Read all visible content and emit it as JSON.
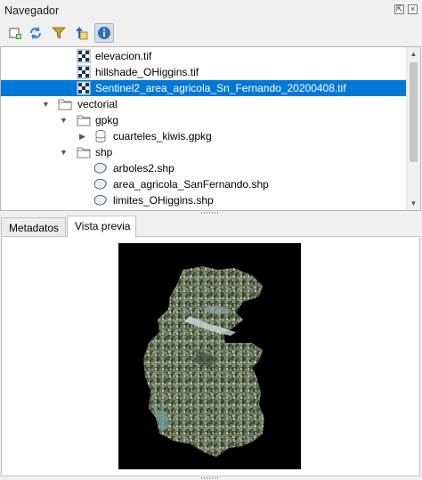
{
  "panel": {
    "title": "Navegador",
    "float_icon": "float-icon",
    "close_icon": "close-icon"
  },
  "toolbar": [
    {
      "name": "add-layer-button",
      "icon": "add-layer-icon"
    },
    {
      "name": "refresh-button",
      "icon": "refresh-icon"
    },
    {
      "name": "filter-button",
      "icon": "filter-icon"
    },
    {
      "name": "collapse-all-button",
      "icon": "collapse-icon"
    },
    {
      "name": "properties-button",
      "icon": "info-icon",
      "active": true
    }
  ],
  "tree": {
    "items": [
      {
        "label": "elevacion.tif",
        "icon": "raster-icon",
        "level": 3
      },
      {
        "label": "hillshade_OHiggins.tif",
        "icon": "raster-icon",
        "level": 3
      },
      {
        "label": "Sentinel2_area_agricola_Sn_Fernando_20200408.tif",
        "icon": "raster-icon",
        "level": 3,
        "selected": true
      },
      {
        "label": "vectorial",
        "icon": "folder-icon",
        "level": 2,
        "expanded": true
      },
      {
        "label": "gpkg",
        "icon": "folder-icon",
        "level": 3,
        "expanded": true
      },
      {
        "label": "cuarteles_kiwis.gpkg",
        "icon": "database-icon",
        "level": 4,
        "collapsed": true
      },
      {
        "label": "shp",
        "icon": "folder-icon",
        "level": 3,
        "expanded": true
      },
      {
        "label": "arboles2.shp",
        "icon": "polygon-icon",
        "level": 4
      },
      {
        "label": "area_agricola_SanFernando.shp",
        "icon": "polygon-icon",
        "level": 4
      },
      {
        "label": "limites_OHiggins.shp",
        "icon": "polygon-icon",
        "level": 4
      }
    ]
  },
  "tabs": [
    {
      "label": "Metadatos",
      "active": false
    },
    {
      "label": "Vista previa",
      "active": true
    }
  ],
  "colors": {
    "selection": "#0078d7",
    "accent_info": "#2f6fb5"
  }
}
